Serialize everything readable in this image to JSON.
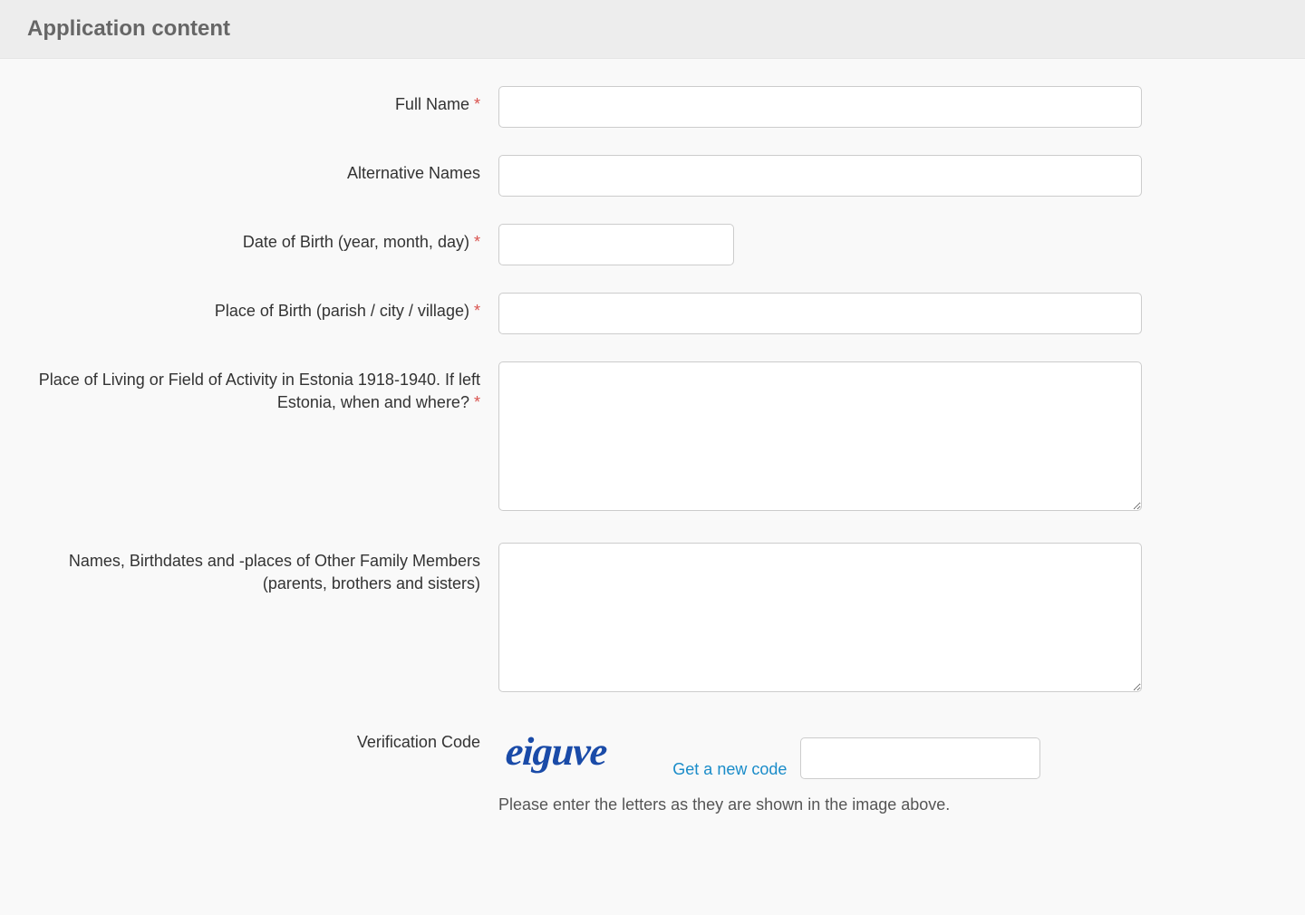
{
  "header": {
    "title": "Application content"
  },
  "form": {
    "full_name": {
      "label": "Full Name",
      "required": "*",
      "value": ""
    },
    "alternative_names": {
      "label": "Alternative Names",
      "value": ""
    },
    "date_of_birth": {
      "label": "Date of Birth (year, month, day)",
      "required": "*",
      "value": ""
    },
    "place_of_birth": {
      "label": "Place of Birth (parish / city / village)",
      "required": "*",
      "value": ""
    },
    "place_of_living": {
      "label": "Place of Living or Field of Activity in Estonia 1918-1940. If left Estonia, when and where?",
      "required": "*",
      "value": ""
    },
    "family_members": {
      "label": "Names, Birthdates and -places of Other Family Members (parents, brothers and sisters)",
      "value": ""
    },
    "verification": {
      "label": "Verification Code",
      "captcha_text": "eiguve",
      "new_code_link": "Get a new code",
      "hint": "Please enter the letters as they are shown in the image above.",
      "value": ""
    }
  }
}
